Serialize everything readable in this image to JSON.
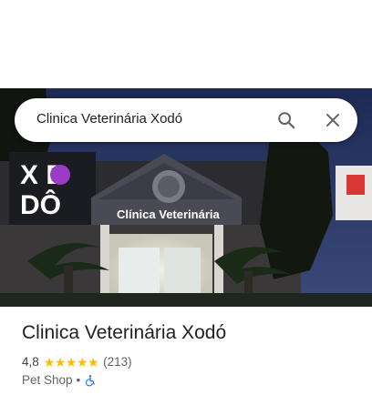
{
  "search": {
    "query": "Clinica Veterinária Xodó"
  },
  "photo": {
    "sign_main": "Clínica Veterinária",
    "logo_text_top": "X  D",
    "logo_text_bottom": "DÔ"
  },
  "place": {
    "name": "Clinica Veterinária Xodó",
    "rating": "4,8",
    "stars": 5,
    "review_count": "(213)",
    "category": "Pet Shop",
    "separator": "•",
    "accessibility_icon": "wheelchair-icon"
  },
  "colors": {
    "star": "#fbbc04",
    "accessibility": "#1a73e8"
  }
}
